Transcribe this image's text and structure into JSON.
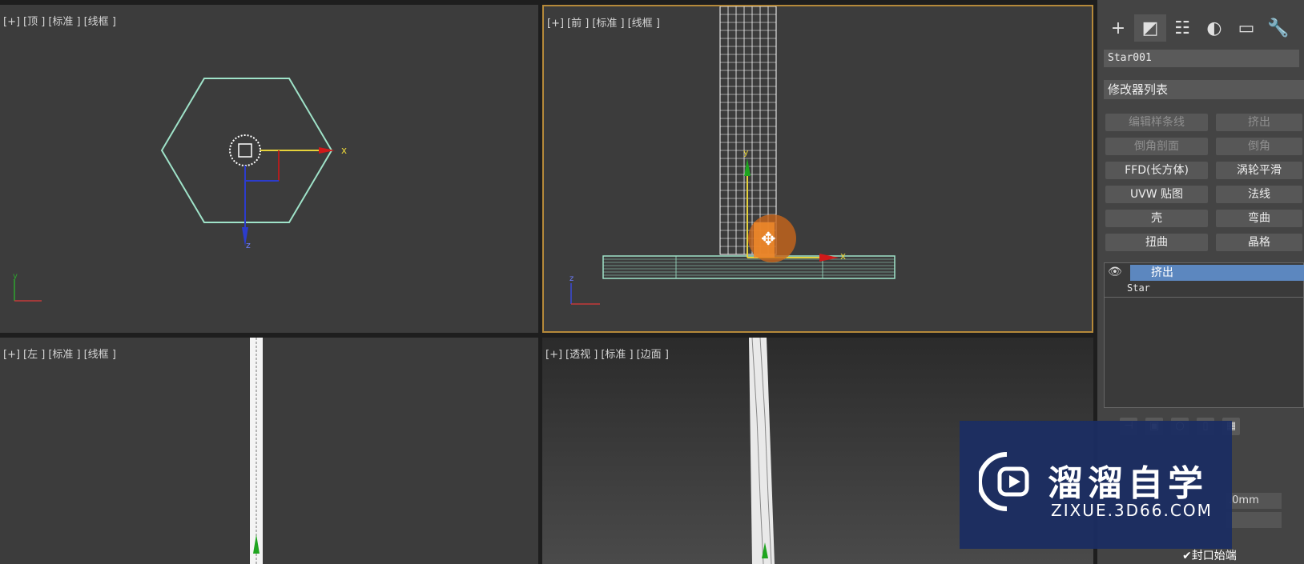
{
  "viewports": {
    "top": {
      "plus": "[+]",
      "view": "[顶 ]",
      "shading": "[标准 ]",
      "mode": "[线框 ]"
    },
    "front": {
      "plus": "[+]",
      "view": "[前 ]",
      "shading": "[标准 ]",
      "mode": "[线框 ]"
    },
    "left": {
      "plus": "[+]",
      "view": "[左 ]",
      "shading": "[标准 ]",
      "mode": "[线框 ]"
    },
    "perspective": {
      "plus": "[+]",
      "view": "[透视 ]",
      "shading": "[标准 ]",
      "mode": "[边面 ]"
    }
  },
  "axis_labels": {
    "x": "x",
    "y": "y",
    "z": "z"
  },
  "panel": {
    "tabs": [
      "create-icon",
      "modify-icon",
      "hierarchy-icon",
      "motion-icon",
      "display-icon",
      "utilities-icon"
    ],
    "object_name": "Star001",
    "modifier_list": "修改器列表",
    "buttons": [
      {
        "label": "编辑样条线",
        "enabled": false
      },
      {
        "label": "挤出",
        "enabled": false
      },
      {
        "label": "倒角剖面",
        "enabled": false
      },
      {
        "label": "倒角",
        "enabled": false
      },
      {
        "label": "FFD(长方体)",
        "enabled": true
      },
      {
        "label": "涡轮平滑",
        "enabled": true
      },
      {
        "label": "UVW 贴图",
        "enabled": true
      },
      {
        "label": "法线",
        "enabled": true
      },
      {
        "label": "壳",
        "enabled": true
      },
      {
        "label": "弯曲",
        "enabled": true
      },
      {
        "label": "扭曲",
        "enabled": true
      },
      {
        "label": "晶格",
        "enabled": true
      }
    ],
    "stack": {
      "active": "挤出",
      "base": "Star"
    },
    "spinner_value": ".0mm",
    "cap_start_label": "封口始端"
  },
  "watermark": {
    "title": "溜溜自学",
    "url": "ZIXUE.3D66.COM"
  },
  "colors": {
    "accent_border": "#b5893a",
    "selection": "#5c87bf",
    "shape": "#9fe3c9"
  }
}
